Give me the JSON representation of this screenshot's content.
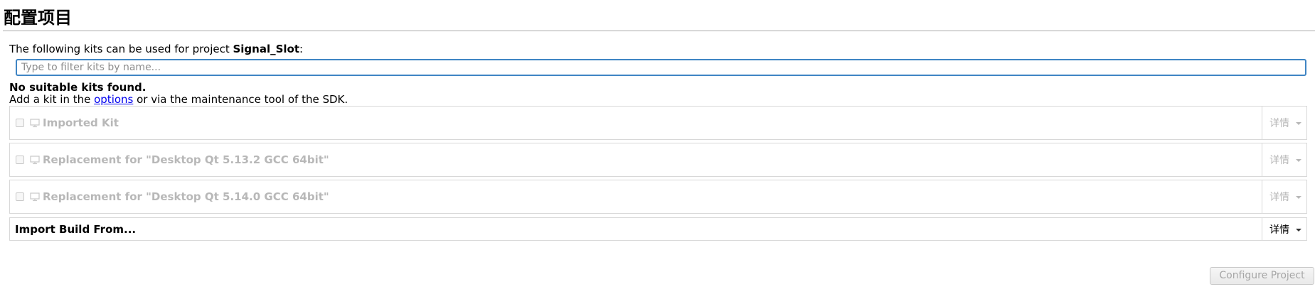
{
  "page": {
    "title": "配置项目"
  },
  "intro": {
    "prefix": "The following kits can be used for project ",
    "project_name": "Signal_Slot",
    "suffix": ":"
  },
  "filter": {
    "placeholder": "Type to filter kits by name...",
    "value": ""
  },
  "warning": {
    "title": "No suitable kits found.",
    "hint_prefix": "Add a kit in the ",
    "hint_link": "options",
    "hint_suffix": " or via the maintenance tool of the SDK."
  },
  "kits": [
    {
      "label": "Imported Kit",
      "details": "详情",
      "checked": false,
      "enabled": false,
      "icon": "monitor-icon"
    },
    {
      "label": "Replacement for \"Desktop Qt 5.13.2 GCC 64bit\"",
      "details": "详情",
      "checked": false,
      "enabled": false,
      "icon": "monitor-icon"
    },
    {
      "label": "Replacement for \"Desktop Qt 5.14.0 GCC 64bit\"",
      "details": "详情",
      "checked": false,
      "enabled": false,
      "icon": "monitor-icon"
    }
  ],
  "import_build": {
    "label": "Import Build From...",
    "details": "详情"
  },
  "footer": {
    "configure_label": "Configure Project",
    "configure_enabled": false
  },
  "colors": {
    "focus_border": "#3f85c4",
    "disabled_text": "#b8b8b8",
    "link": "#0000ee"
  }
}
